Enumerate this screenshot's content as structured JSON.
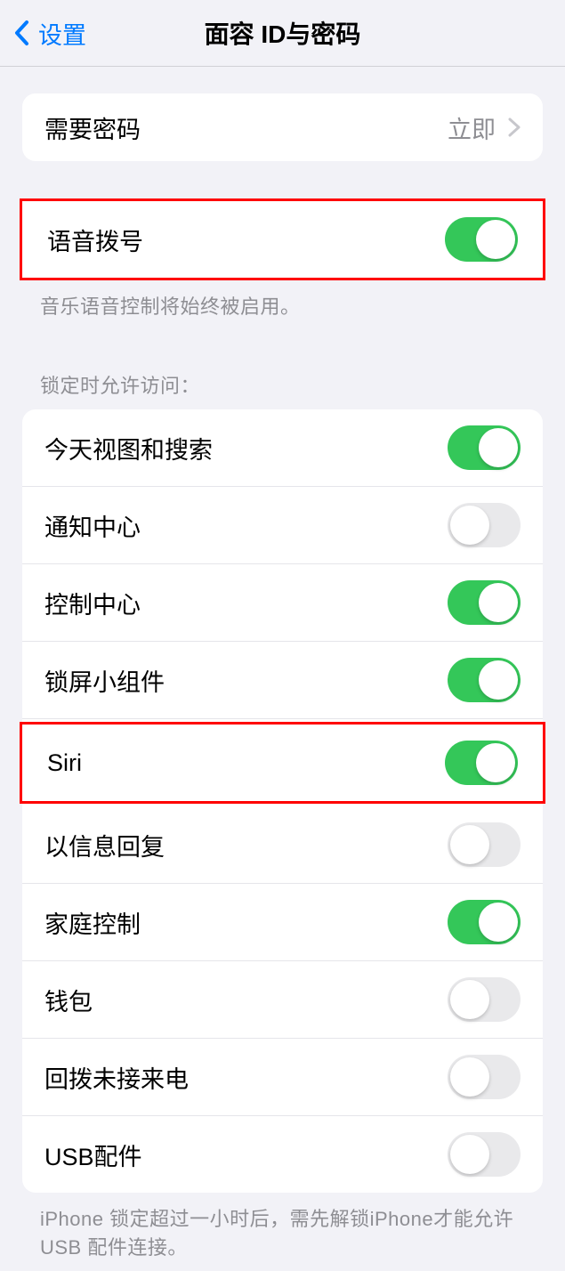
{
  "header": {
    "back_label": "设置",
    "title": "面容 ID与密码"
  },
  "passcode": {
    "label": "需要密码",
    "value": "立即"
  },
  "voice_dial": {
    "label": "语音拨号",
    "enabled": true,
    "footer": "音乐语音控制将始终被启用。"
  },
  "lock_access": {
    "header": "锁定时允许访问：",
    "items": [
      {
        "label": "今天视图和搜索",
        "enabled": true
      },
      {
        "label": "通知中心",
        "enabled": false
      },
      {
        "label": "控制中心",
        "enabled": true
      },
      {
        "label": "锁屏小组件",
        "enabled": true
      },
      {
        "label": "Siri",
        "enabled": true
      },
      {
        "label": "以信息回复",
        "enabled": false
      },
      {
        "label": "家庭控制",
        "enabled": true
      },
      {
        "label": "钱包",
        "enabled": false
      },
      {
        "label": "回拨未接来电",
        "enabled": false
      },
      {
        "label": "USB配件",
        "enabled": false
      }
    ],
    "footer": "iPhone 锁定超过一小时后，需先解锁iPhone才能允许USB 配件连接。"
  }
}
